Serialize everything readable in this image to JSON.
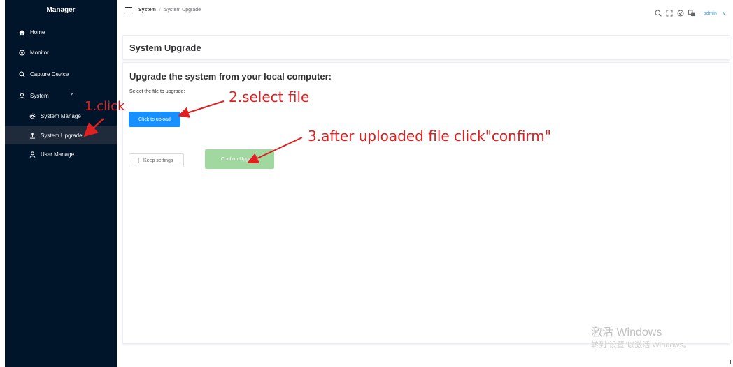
{
  "sidebar": {
    "title": "Manager",
    "items": [
      {
        "label": "Home",
        "icon": "home-icon"
      },
      {
        "label": "Monitor",
        "icon": "monitor-icon"
      },
      {
        "label": "Capture Device",
        "icon": "search-icon"
      },
      {
        "label": "System",
        "icon": "user-icon",
        "caret": "^"
      },
      {
        "label": "System Manage",
        "icon": "gear-icon"
      },
      {
        "label": "System Upgrade",
        "icon": "upload-icon"
      },
      {
        "label": "User Manage",
        "icon": "user-icon"
      }
    ]
  },
  "header": {
    "breadcrumb": {
      "parent": "System",
      "separator": "/",
      "current": "System Upgrade"
    },
    "user": "admin",
    "user_caret": "∨"
  },
  "page": {
    "title": "System Upgrade",
    "heading": "Upgrade the system from your local computer:",
    "select_label": "Select the file to upgrade:",
    "upload_button": "Click to upload",
    "keep_settings": "Keep settings",
    "confirm_button": "Confirm Upgrade"
  },
  "annotations": {
    "step1": "1.click",
    "step2": "2.select file",
    "step3": "3.after uploaded file click\"confirm\"",
    "color": "#e02020"
  },
  "watermark": {
    "line1": "激活 Windows",
    "line2": "转到“设置”以激活 Windows。"
  },
  "colors": {
    "sidebar_bg": "#001529",
    "primary": "#1890ff",
    "confirm_disabled": "#a0d8a0",
    "link": "#409eff"
  }
}
